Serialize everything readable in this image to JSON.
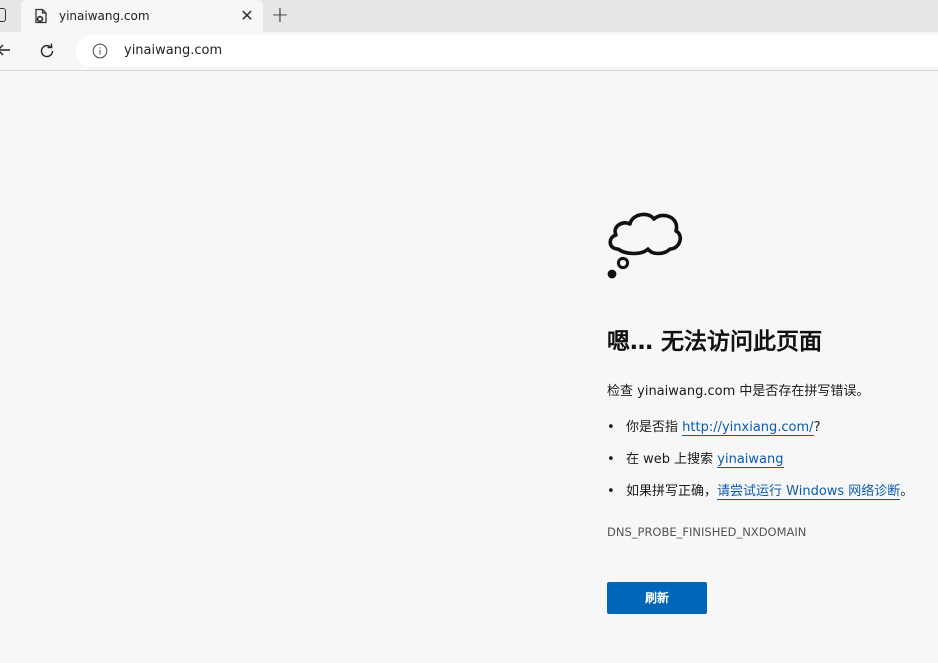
{
  "tab": {
    "title": "yinaiwang.com",
    "close_icon": "close-icon",
    "new_tab_icon": "plus-icon"
  },
  "toolbar": {
    "url": "yinaiwang.com",
    "info_icon": "info-icon"
  },
  "error": {
    "icon": "thought-cloud-icon",
    "title": "嗯… 无法访问此页面",
    "check_text": "检查 yinaiwang.com 中是否存在拼写错误。",
    "suggestions": [
      {
        "bullet": "•",
        "prefix": "你是否指 ",
        "link": "http://yinxiang.com/",
        "suffix": "?"
      },
      {
        "bullet": "•",
        "prefix": "在 web 上搜索 ",
        "link": "yinaiwang",
        "suffix": ""
      },
      {
        "bullet": "•",
        "prefix": "如果拼写正确，",
        "link": "请尝试运行 Windows 网络诊断",
        "suffix": "。"
      }
    ],
    "code": "DNS_PROBE_FINISHED_NXDOMAIN",
    "reload_label": "刷新"
  },
  "colors": {
    "accent": "#0067b8",
    "link": "#0b5cad",
    "page_bg": "#f7f7f7"
  }
}
